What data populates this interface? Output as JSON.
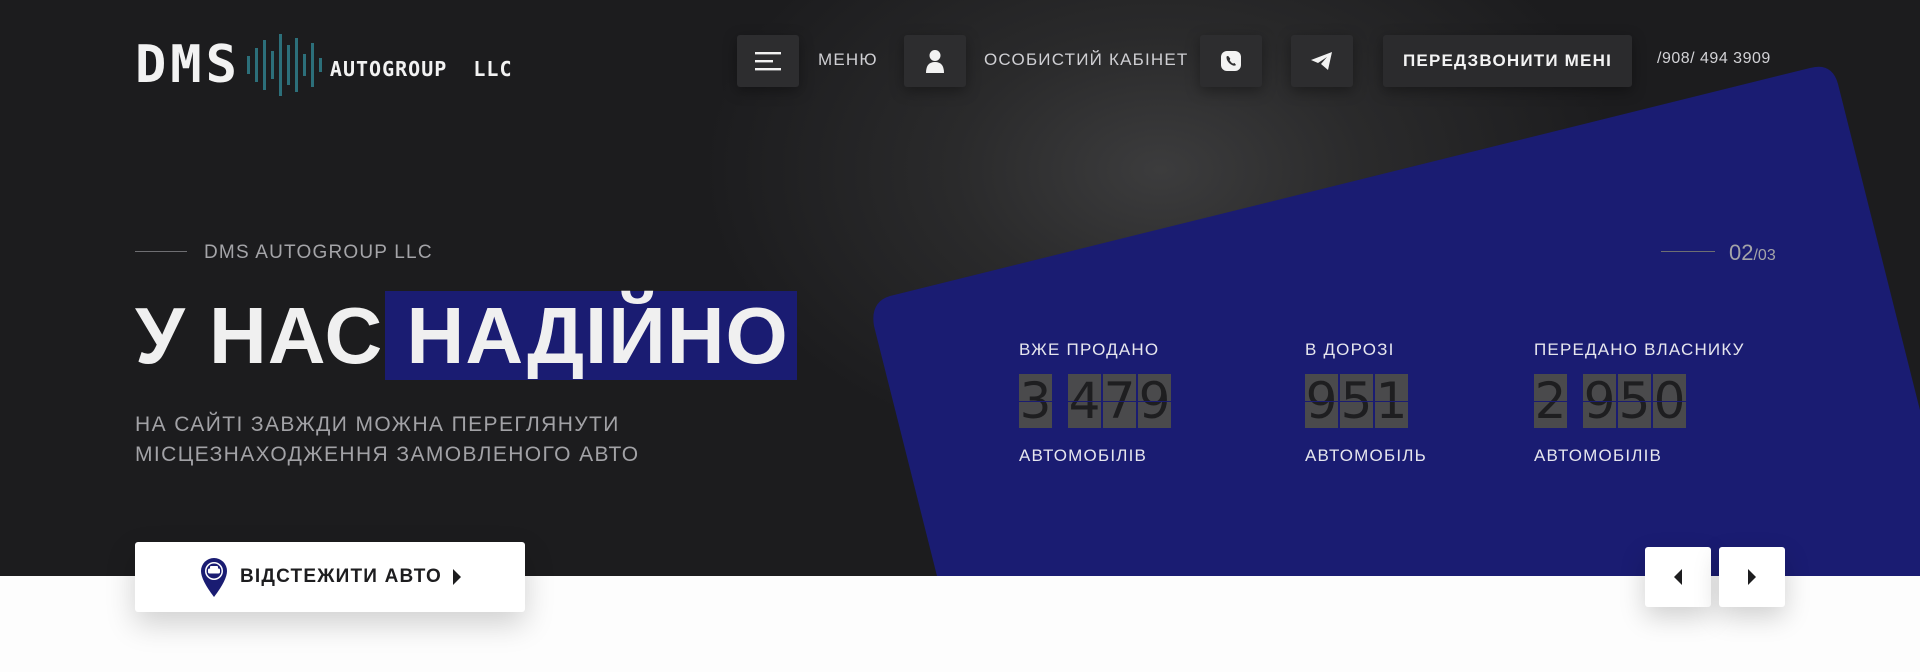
{
  "header": {
    "logo": {
      "main": "DMS",
      "suffix": "AUTOGROUP  LLC"
    },
    "menu_label": "МЕНЮ",
    "cabinet_label": "ОСОБИСТИЙ КАБІНЕТ",
    "callback_label": "ПЕРЕДЗВОНИТИ МЕНІ",
    "phone": "/908/ 494 3909",
    "icons": [
      "hamburger-menu-icon",
      "user-icon",
      "viber-phone-icon",
      "telegram-icon"
    ]
  },
  "hero": {
    "kicker": "DMS AUTOGROUP LLC",
    "title_plain": "У НАС ",
    "title_highlight": "НАДІЙНО",
    "subtitle_line1": "НА САЙТІ ЗАВЖДИ МОЖНА ПЕРЕГЛЯНУТИ",
    "subtitle_line2": "МІСЦЕЗНАХОДЖЕННЯ ЗАМОВЛЕНОГО АВТО",
    "slide_current": "02",
    "slide_total": "/03",
    "track_label": "ВІДСТЕЖИТИ АВТО"
  },
  "stats": [
    {
      "label": "ВЖЕ ПРОДАНО",
      "groups": [
        "3",
        "479"
      ],
      "unit": "АВТОМОБІЛІВ"
    },
    {
      "label": "В ДОРОЗІ",
      "groups": [
        "951"
      ],
      "unit": "АВТОМОБІЛЬ"
    },
    {
      "label": "ПЕРЕДАНО ВЛАСНИКУ",
      "groups": [
        "2",
        "950"
      ],
      "unit": "АВТОМОБІЛІВ"
    }
  ],
  "colors": {
    "background_dark": "#1c1c1e",
    "accent_blue": "#1a1c72",
    "logo_teal": "#2c6f7a",
    "white": "#ffffff"
  }
}
